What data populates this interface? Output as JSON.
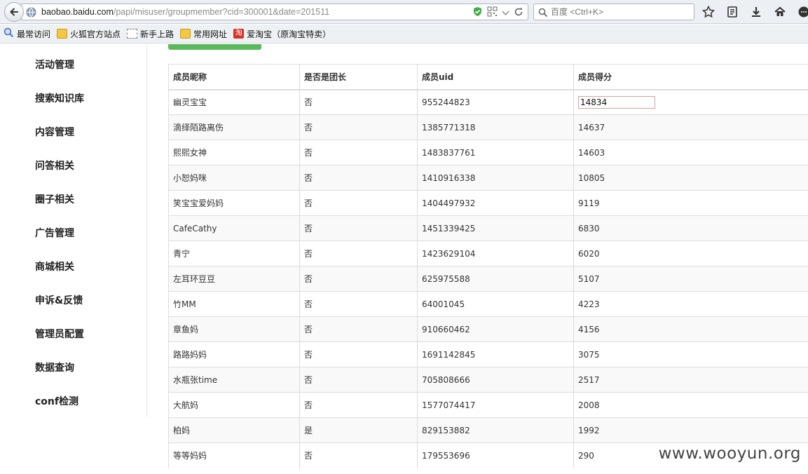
{
  "browser": {
    "url_host": "baobao.baidu.com",
    "url_path": "/papi/misuser/groupmember?cid=300001&date=201511",
    "search_placeholder": "百度 <Ctrl+K>",
    "bookmarks": [
      {
        "label": "最常访问",
        "icon": "globe-icon"
      },
      {
        "label": "火狐官方站点",
        "icon": "folder-icon"
      },
      {
        "label": "新手上路",
        "icon": "dashed-page-icon"
      },
      {
        "label": "常用网址",
        "icon": "folder-icon"
      },
      {
        "label": "爱淘宝（原淘宝特卖）",
        "icon": "taobao-icon",
        "icon_text": "淘"
      }
    ]
  },
  "sidebar": {
    "items": [
      {
        "label": "活动管理"
      },
      {
        "label": "搜索知识库"
      },
      {
        "label": "内容管理"
      },
      {
        "label": "问答相关"
      },
      {
        "label": "圈子相关"
      },
      {
        "label": "广告管理"
      },
      {
        "label": "商城相关"
      },
      {
        "label": "申诉&反馈"
      },
      {
        "label": "管理员配置"
      },
      {
        "label": "数据查询"
      },
      {
        "label": "conf检测"
      }
    ]
  },
  "table": {
    "headers": [
      "成员昵称",
      "是否是团长",
      "成员uid",
      "成员得分"
    ],
    "rows": [
      [
        "幽灵宝宝",
        "否",
        "955244823",
        "14834"
      ],
      [
        "滴绎陌路离伤",
        "否",
        "1385771318",
        "14637"
      ],
      [
        "熙熙女神",
        "否",
        "1483837761",
        "14603"
      ],
      [
        "小恕妈咪",
        "否",
        "1410916338",
        "10805"
      ],
      [
        "笑宝宝爱妈妈",
        "否",
        "1404497932",
        "9119"
      ],
      [
        "CafeCathy",
        "否",
        "1451339425",
        "6830"
      ],
      [
        "青宁",
        "否",
        "1423629104",
        "6020"
      ],
      [
        "左耳环豆豆",
        "否",
        "625975588",
        "5107"
      ],
      [
        "竹MM",
        "否",
        "64001045",
        "4223"
      ],
      [
        "章鱼妈",
        "否",
        "910660462",
        "4156"
      ],
      [
        "路路妈妈",
        "否",
        "1691142845",
        "3075"
      ],
      [
        "水瓶张time",
        "否",
        "705808666",
        "2517"
      ],
      [
        "大航妈",
        "否",
        "1577074417",
        "2008"
      ],
      [
        "柏妈",
        "是",
        "829153882",
        "1992"
      ],
      [
        "等等妈妈",
        "否",
        "179553696",
        "290"
      ]
    ]
  },
  "watermark": "www.wooyun.org",
  "colors": {
    "accent_green": "#5cb85c",
    "row_stripe": "#f9f9f9"
  }
}
